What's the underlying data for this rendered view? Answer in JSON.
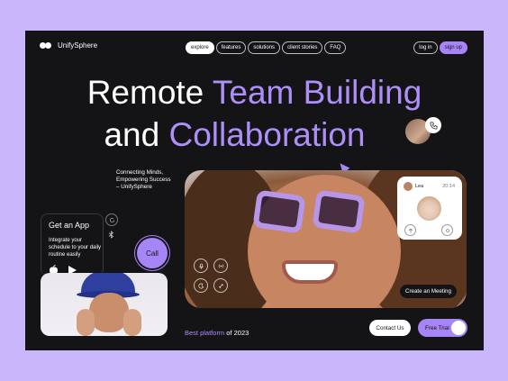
{
  "brand": {
    "name": "UnifySphere"
  },
  "nav": {
    "items": [
      "explore",
      "features",
      "solutions",
      "client stories",
      "FAQ"
    ],
    "active": "explore"
  },
  "auth": {
    "login": "log in",
    "signup": "sign up"
  },
  "hero": {
    "line1_plain": "Remote ",
    "line1_highlight": "Team Building",
    "line2_plain": "and ",
    "line2_highlight": "Collaboration"
  },
  "tagline": {
    "line1": "Connecting Minds,",
    "line2": "Empowering Success",
    "line3": "– UnifySphere"
  },
  "get_app": {
    "title": "Get an App",
    "description": "Integrate your schedule to your daily routine easily"
  },
  "call_button": {
    "label": "Call"
  },
  "call_card": {
    "name": "Lea",
    "time": "20:14"
  },
  "create_meeting": {
    "label": "Create an Meeting"
  },
  "footer": {
    "best_highlight": "Best platform",
    "best_rest": " of 2023"
  },
  "cta": {
    "contact": "Contact Us",
    "trial": "Free Trial"
  },
  "colors": {
    "accent": "#a686f7",
    "background": "#c9b6fb",
    "frame": "#141316"
  },
  "icons": [
    "phone-icon",
    "refresh-icon",
    "bluetooth-icon",
    "apple-icon",
    "play-store-icon",
    "mic-icon",
    "signal-icon",
    "moon-icon",
    "link-icon"
  ]
}
